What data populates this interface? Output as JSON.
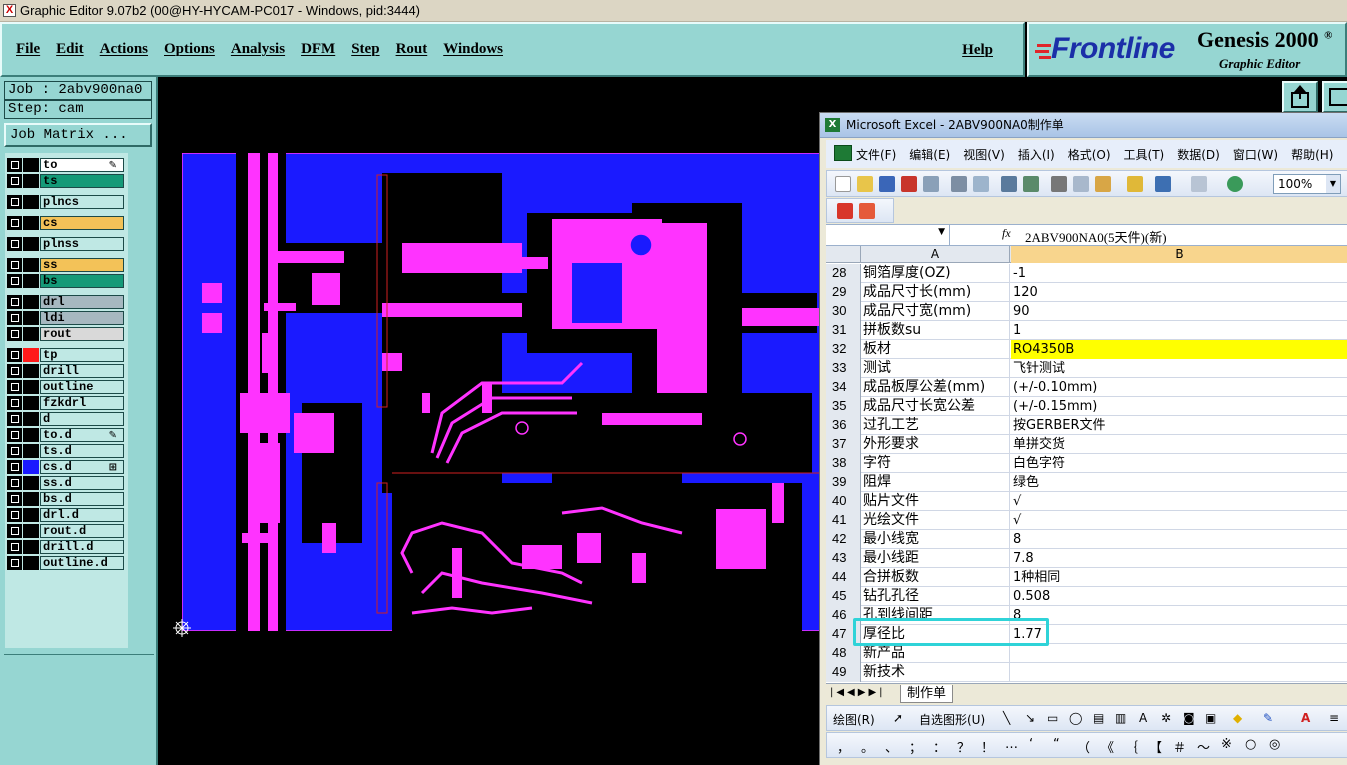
{
  "genesis": {
    "window_title": "Graphic Editor 9.07b2 (00@HY-HYCAM-PC017 - Windows, pid:3444)",
    "menus": [
      "File",
      "Edit",
      "Actions",
      "Options",
      "Analysis",
      "DFM",
      "Step",
      "Rout",
      "Windows"
    ],
    "help": "Help",
    "logo": {
      "brand": "Frontline",
      "product": "Genesis 2000",
      "product_mark": "®",
      "subtitle": "Graphic Editor"
    },
    "job": "Job : 2abv900na0",
    "step": "Step: cam",
    "job_matrix": "Job Matrix ...",
    "layers": [
      {
        "name": "to",
        "color": "#ffffff",
        "mark": "✎"
      },
      {
        "name": "ts",
        "color": "#159a78",
        "mark": ""
      },
      {
        "name": "plncs",
        "color": "#bfe8e4",
        "mark": ""
      },
      {
        "name": "cs",
        "color": "#f3c258",
        "mark": ""
      },
      {
        "name": "plnss",
        "color": "#bfe8e4",
        "mark": ""
      },
      {
        "name": "ss",
        "color": "#f3c258",
        "mark": ""
      },
      {
        "name": "bs",
        "color": "#159a78",
        "mark": ""
      },
      {
        "name": "drl",
        "color": "#a6b8c0",
        "mark": ""
      },
      {
        "name": "ldi",
        "color": "#a6b8c0",
        "mark": ""
      },
      {
        "name": "rout",
        "color": "#d9d9d9",
        "mark": ""
      },
      {
        "name": "tp",
        "color": "#bfe8e4",
        "mark": "",
        "swatch": "#ff1a1a"
      },
      {
        "name": "drill",
        "color": "#bfe8e4",
        "mark": ""
      },
      {
        "name": "outline",
        "color": "#bfe8e4",
        "mark": ""
      },
      {
        "name": "fzkdrl",
        "color": "#bfe8e4",
        "mark": ""
      },
      {
        "name": "d",
        "color": "#bfe8e4",
        "mark": ""
      },
      {
        "name": "to.d",
        "color": "#bfe8e4",
        "mark": "✎"
      },
      {
        "name": "ts.d",
        "color": "#bfe8e4",
        "mark": ""
      },
      {
        "name": "cs.d",
        "color": "#bfe8e4",
        "mark": "⊞",
        "swatch": "#1a1aff"
      },
      {
        "name": "ss.d",
        "color": "#bfe8e4",
        "mark": ""
      },
      {
        "name": "bs.d",
        "color": "#bfe8e4",
        "mark": ""
      },
      {
        "name": "drl.d",
        "color": "#bfe8e4",
        "mark": ""
      },
      {
        "name": "rout.d",
        "color": "#bfe8e4",
        "mark": ""
      },
      {
        "name": "drill.d",
        "color": "#bfe8e4",
        "mark": ""
      },
      {
        "name": "outline.d",
        "color": "#bfe8e4",
        "mark": ""
      }
    ],
    "colors": {
      "board": "#1a1aff",
      "copper": "#ff33ff",
      "background": "#000000",
      "panel": "#96d6d2"
    }
  },
  "excel": {
    "window_title": "Microsoft Excel - 2ABV900NA0制作单",
    "menus": [
      "文件(F)",
      "编辑(E)",
      "视图(V)",
      "插入(I)",
      "格式(O)",
      "工具(T)",
      "数据(D)",
      "窗口(W)",
      "帮助(H)"
    ],
    "zoom": "100%",
    "name_box": "",
    "fx": "fx",
    "formula_value": "2ABV900NA0(5天件)(新)",
    "columns": [
      "A",
      "B"
    ],
    "rows": [
      {
        "num": "28",
        "a": "铜箔厚度(OZ)",
        "b": "-1"
      },
      {
        "num": "29",
        "a": "成品尺寸长(mm)",
        "b": "120"
      },
      {
        "num": "30",
        "a": "成品尺寸宽(mm)",
        "b": "90"
      },
      {
        "num": "31",
        "a": "拼板数su",
        "b": "1"
      },
      {
        "num": "32",
        "a": "板材",
        "b": "RO4350B",
        "highlight": true
      },
      {
        "num": "33",
        "a": "测试",
        "b": "飞针测试"
      },
      {
        "num": "34",
        "a": "成品板厚公差(mm)",
        "b": "(+/-0.10mm)"
      },
      {
        "num": "35",
        "a": "成品尺寸长宽公差",
        "b": "(+/-0.15mm)"
      },
      {
        "num": "36",
        "a": "过孔工艺",
        "b": "按GERBER文件"
      },
      {
        "num": "37",
        "a": "外形要求",
        "b": "单拼交货"
      },
      {
        "num": "38",
        "a": "字符",
        "b": "白色字符"
      },
      {
        "num": "39",
        "a": "阻焊",
        "b": "绿色"
      },
      {
        "num": "40",
        "a": "贴片文件",
        "b": "√"
      },
      {
        "num": "41",
        "a": "光绘文件",
        "b": "√"
      },
      {
        "num": "42",
        "a": "最小线宽",
        "b": "8"
      },
      {
        "num": "43",
        "a": "最小线距",
        "b": "7.8"
      },
      {
        "num": "44",
        "a": "合拼板数",
        "b": "1种相同"
      },
      {
        "num": "45",
        "a": "钻孔孔径",
        "b": "0.508"
      },
      {
        "num": "46",
        "a": "孔到线间距",
        "b": "8"
      },
      {
        "num": "47",
        "a": "厚径比",
        "b": "1.77"
      },
      {
        "num": "48",
        "a": "新产品",
        "b": ""
      },
      {
        "num": "49",
        "a": "新技术",
        "b": ""
      }
    ],
    "sheet_tab": "制作单",
    "draw_label": "绘图(R)",
    "autoshape_label": "自选图形(U)",
    "symbols": [
      "，",
      "。",
      "、",
      "；",
      "：",
      "？",
      "！",
      "…",
      "‘",
      "“",
      "（",
      "《",
      "｛",
      "【",
      "＃",
      "～",
      "※",
      "○",
      "◎"
    ]
  }
}
